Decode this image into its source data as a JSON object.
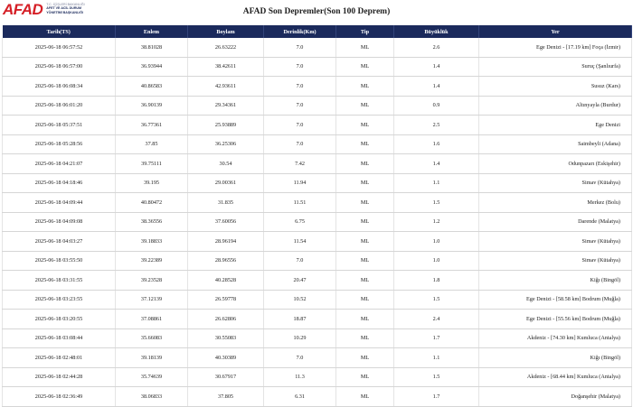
{
  "brand": {
    "logo_text": "AFAD",
    "subtitle_line1": "T.C. İÇİŞLERİ BAKANLIĞI",
    "subtitle_line2": "AFET VE ACİL DURUM",
    "subtitle_line3": "YÖNETİMİ BAŞKANLIĞI"
  },
  "page_title": "AFAD Son Depremler(Son 100 Deprem)",
  "columns": [
    "Tarih(TS)",
    "Enlem",
    "Boylam",
    "Derinlik(Km)",
    "Tip",
    "Büyüklük",
    "Yer"
  ],
  "rows": [
    [
      "2025-06-18 06:57:52",
      "38.81028",
      "26.63222",
      "7.0",
      "ML",
      "2.6",
      "Ege Denizi - [17.19 km] Foça (İzmir)"
    ],
    [
      "2025-06-18 06:57:00",
      "36.93944",
      "38.42611",
      "7.0",
      "ML",
      "1.4",
      "Suruç (Şanlıurfa)"
    ],
    [
      "2025-06-18 06:08:34",
      "40.86583",
      "42.93611",
      "7.0",
      "ML",
      "1.4",
      "Susuz (Kars)"
    ],
    [
      "2025-06-18 06:01:20",
      "36.90139",
      "29.34361",
      "7.0",
      "ML",
      "0.9",
      "Altınyayla (Burdur)"
    ],
    [
      "2025-06-18 05:37:51",
      "36.77361",
      "25.93889",
      "7.0",
      "ML",
      "2.5",
      "Ege Denizi"
    ],
    [
      "2025-06-18 05:28:56",
      "37.85",
      "36.25306",
      "7.0",
      "ML",
      "1.6",
      "Saimbeyli (Adana)"
    ],
    [
      "2025-06-18 04:21:07",
      "39.75111",
      "30.54",
      "7.42",
      "ML",
      "1.4",
      "Odunpazarı (Eskişehir)"
    ],
    [
      "2025-06-18 04:18:46",
      "39.195",
      "29.00361",
      "11.94",
      "ML",
      "1.1",
      "Simav (Kütahya)"
    ],
    [
      "2025-06-18 04:09:44",
      "40.80472",
      "31.835",
      "11.51",
      "ML",
      "1.5",
      "Merkez (Bolu)"
    ],
    [
      "2025-06-18 04:09:08",
      "38.36556",
      "37.60056",
      "6.75",
      "ML",
      "1.2",
      "Darende (Malatya)"
    ],
    [
      "2025-06-18 04:03:27",
      "39.18833",
      "28.96194",
      "11.54",
      "ML",
      "1.0",
      "Simav (Kütahya)"
    ],
    [
      "2025-06-18 03:55:50",
      "39.22389",
      "28.96556",
      "7.0",
      "ML",
      "1.0",
      "Simav (Kütahya)"
    ],
    [
      "2025-06-18 03:31:55",
      "39.23528",
      "40.28528",
      "20.47",
      "ML",
      "1.8",
      "Kiğı (Bingöl)"
    ],
    [
      "2025-06-18 03:23:55",
      "37.12139",
      "26.59778",
      "10.52",
      "ML",
      "1.5",
      "Ege Denizi - [58.58 km] Bodrum (Muğla)"
    ],
    [
      "2025-06-18 03:20:55",
      "37.08861",
      "26.62806",
      "18.87",
      "ML",
      "2.4",
      "Ege Denizi - [55.56 km] Bodrum (Muğla)"
    ],
    [
      "2025-06-18 03:08:44",
      "35.66083",
      "30.55083",
      "10.29",
      "ML",
      "1.7",
      "Akdeniz - [74.30 km] Kumluca (Antalya)"
    ],
    [
      "2025-06-18 02:48:01",
      "39.18139",
      "40.30389",
      "7.0",
      "ML",
      "1.1",
      "Kiğı (Bingöl)"
    ],
    [
      "2025-06-18 02:44:28",
      "35.74639",
      "30.67917",
      "11.3",
      "ML",
      "1.5",
      "Akdeniz - [68.44 km] Kumluca (Antalya)"
    ],
    [
      "2025-06-18 02:36:49",
      "38.06833",
      "37.805",
      "6.31",
      "ML",
      "1.7",
      "Doğanşehir (Malatya)"
    ]
  ]
}
